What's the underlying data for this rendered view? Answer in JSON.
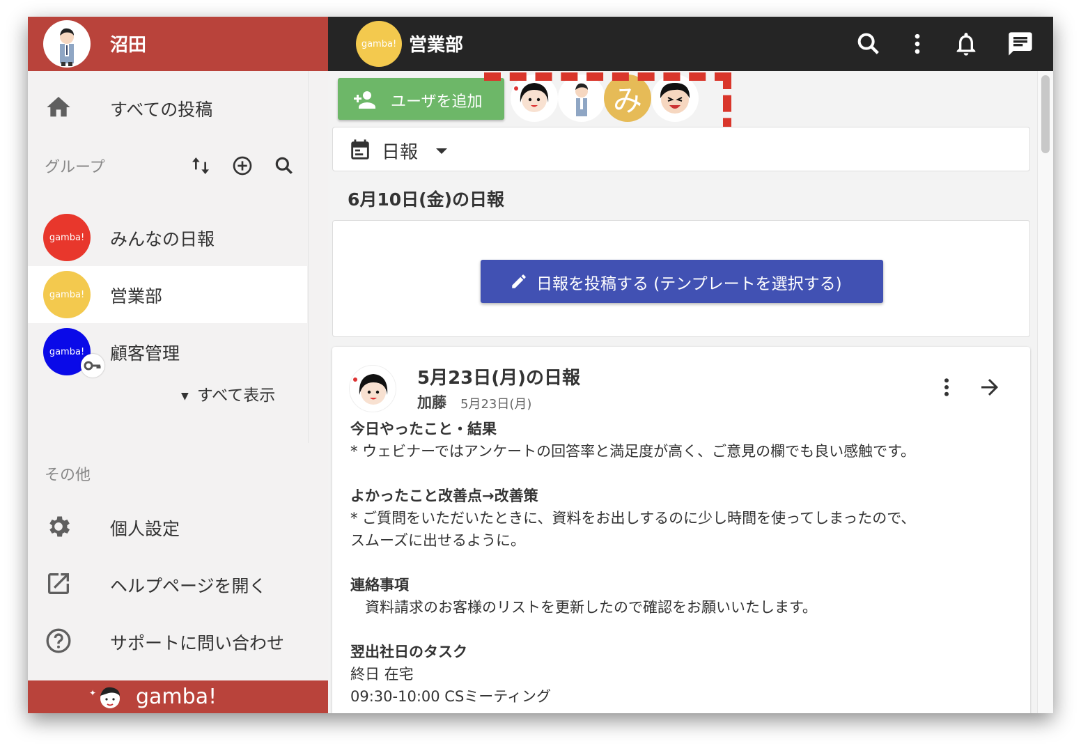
{
  "sidebar": {
    "user_name": "沼田",
    "all_posts": "すべての投稿",
    "groups_title": "グループ",
    "groups": [
      {
        "label": "みんなの日報",
        "logo": "gamba!",
        "color": "#e8372c"
      },
      {
        "label": "営業部",
        "logo": "gamba!",
        "color": "#f3c94e"
      },
      {
        "label": "顧客管理",
        "logo": "gamba!",
        "color": "#0a0ae8"
      }
    ],
    "show_all": "すべて表示",
    "other_title": "その他",
    "other_items": [
      {
        "label": "個人設定",
        "icon": "gear-icon"
      },
      {
        "label": "ヘルプページを開く",
        "icon": "open-external-icon"
      },
      {
        "label": "サポートに問い合わせ",
        "icon": "help-circle-icon"
      }
    ],
    "footer_brand": "gamba!"
  },
  "topbar": {
    "group_logo": "gamba!",
    "group_name": "営業部"
  },
  "main": {
    "add_user_label": "ユーザを追加",
    "member_initial": "み",
    "report_type": "日報",
    "date_heading": "6月10日(金)の日報",
    "post_button": "日報を投稿する (テンプレートを選択する)",
    "report": {
      "title": "5月23日(月)の日報",
      "author": "加藤",
      "date": "5月23日(月)",
      "sections": [
        {
          "heading": "今日やったこと・結果",
          "lines": [
            "* ウェビナーではアンケートの回答率と満足度が高く、ご意見の欄でも良い感触です。"
          ]
        },
        {
          "heading": "よかったこと改善点→改善策",
          "lines": [
            "* ご質問をいただいたときに、資料をお出しするのに少し時間を使ってしまったので、",
            "スムーズに出せるように。"
          ]
        },
        {
          "heading": "連絡事項",
          "lines": [
            "　資料請求のお客様のリストを更新したので確認をお願いいたします。"
          ]
        },
        {
          "heading": "翌出社日のタスク",
          "lines": [
            "終日 在宅",
            "09:30-10:00 CSミーティング"
          ]
        }
      ]
    }
  },
  "colors": {
    "brand_red": "#b9433b",
    "topbar": "#252525",
    "add_user_green": "#6db768",
    "post_button_blue": "#4151b3",
    "highlight_dash": "#d9362b"
  }
}
